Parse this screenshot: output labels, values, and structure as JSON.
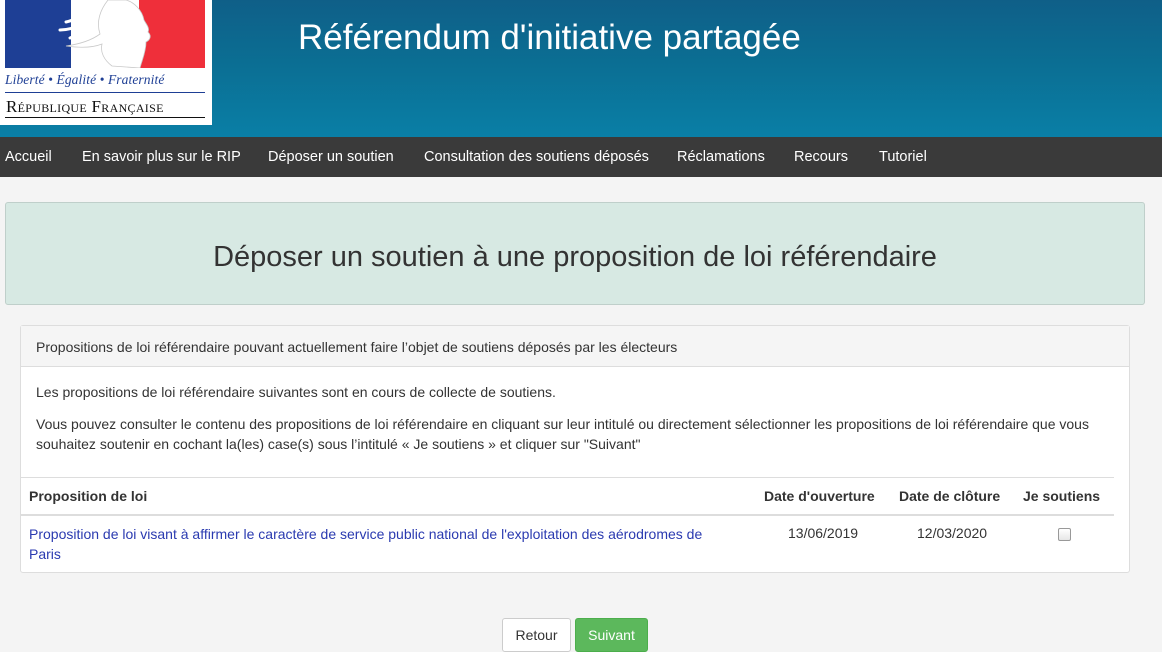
{
  "logo": {
    "motto": "Liberté • Égalité • Fraternité",
    "republic": "République Française",
    "colors": {
      "blue": "#1e3f95",
      "red": "#ef2f3a"
    }
  },
  "header": {
    "title": "Référendum d'initiative partagée"
  },
  "nav": {
    "items": [
      {
        "label": "Accueil"
      },
      {
        "label": "En savoir plus sur le RIP"
      },
      {
        "label": "Déposer un soutien"
      },
      {
        "label": "Consultation des soutiens déposés"
      },
      {
        "label": "Réclamations"
      },
      {
        "label": "Recours"
      },
      {
        "label": "Tutoriel"
      }
    ]
  },
  "page": {
    "title": "Déposer un soutien à une proposition de loi référendaire"
  },
  "panel": {
    "heading": "Propositions de loi référendaire pouvant actuellement faire l’objet de soutiens déposés par les électeurs",
    "intro": "Les propositions de loi référendaire suivantes sont en cours de collecte de soutiens.",
    "instructions": "Vous pouvez consulter le contenu des propositions de loi référendaire en cliquant sur leur intitulé ou directement sélectionner les propositions de loi référendaire que vous souhaitez soutenir en cochant la(les) case(s) sous l’intitulé « Je soutiens » et cliquer sur \"Suivant\""
  },
  "table": {
    "headers": {
      "proposition": "Proposition de loi",
      "opening": "Date d'ouverture",
      "closing": "Date de clôture",
      "support": "Je soutiens"
    },
    "rows": [
      {
        "proposition": "Proposition de loi visant à affirmer le caractère de service public national de l'exploitation des aérodromes de Paris",
        "opening": "13/06/2019",
        "closing": "12/03/2020",
        "checked": false
      }
    ]
  },
  "buttons": {
    "back": "Retour",
    "next": "Suivant"
  }
}
